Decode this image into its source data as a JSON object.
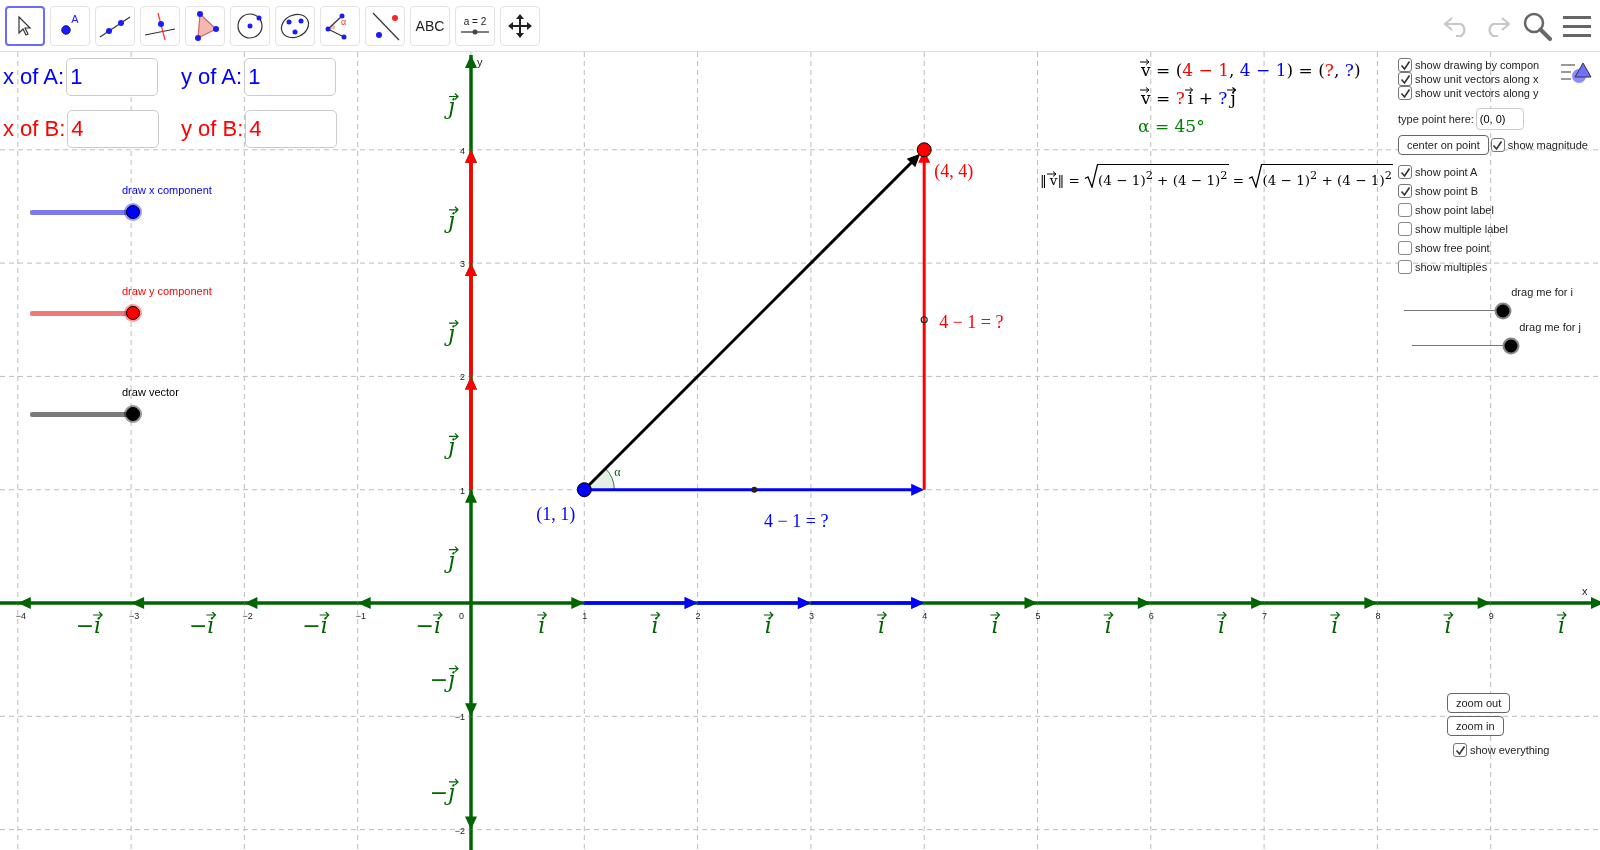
{
  "toolbar": {
    "tools": [
      {
        "kind": "move",
        "selected": true
      },
      {
        "kind": "point",
        "label": "A",
        "selected": false
      },
      {
        "kind": "line",
        "selected": false
      },
      {
        "kind": "perpendicular",
        "selected": false
      },
      {
        "kind": "polygon",
        "selected": false
      },
      {
        "kind": "circle",
        "selected": false
      },
      {
        "kind": "conic",
        "selected": false
      },
      {
        "kind": "angle",
        "label": "α",
        "selected": false
      },
      {
        "kind": "reflect",
        "selected": false
      },
      {
        "kind": "text",
        "label": "ABC",
        "selected": false
      },
      {
        "kind": "slider",
        "label": "a = 2",
        "selected": false
      },
      {
        "kind": "pan",
        "selected": false
      }
    ],
    "undo": {
      "disabled": true
    },
    "redo": {
      "disabled": true
    }
  },
  "inputs": [
    {
      "label": "x of A:",
      "value": "1",
      "color": "#0000ff"
    },
    {
      "label": "y of A:",
      "value": "1",
      "color": "#0000ff"
    },
    {
      "label": "x of B:",
      "value": "4",
      "color": "#ff0000"
    },
    {
      "label": "y of B:",
      "value": "4",
      "color": "#ff0000"
    }
  ],
  "sliders": [
    {
      "label": "draw x component",
      "level": 1,
      "color": "#0000ff"
    },
    {
      "label": "draw y component",
      "level": 1,
      "color": "#ff0000"
    },
    {
      "label": "draw vector",
      "level": 1,
      "color": "#000000"
    }
  ],
  "formulas": [
    [
      {
        "kind": "vector",
        "text": "v"
      },
      {
        "kind": "text",
        "text": " = ("
      },
      {
        "kind": "text",
        "text": "4 − 1",
        "color": "#ff0000"
      },
      {
        "kind": "text",
        "text": ", "
      },
      {
        "kind": "text",
        "text": "4 − 1",
        "color": "#0000ff"
      },
      {
        "kind": "text",
        "text": ") = ("
      },
      {
        "kind": "text",
        "text": "?",
        "color": "#ff0000"
      },
      {
        "kind": "text",
        "text": ", "
      },
      {
        "kind": "text",
        "text": "?",
        "color": "#0000ff"
      },
      {
        "kind": "text",
        "text": ")"
      }
    ],
    [
      {
        "kind": "vector",
        "text": "v"
      },
      {
        "kind": "text",
        "text": " = "
      },
      {
        "kind": "text",
        "text": "?",
        "color": "#ff0000"
      },
      {
        "kind": "vector",
        "text": "i"
      },
      {
        "kind": "text",
        "text": " + "
      },
      {
        "kind": "text",
        "text": "?",
        "color": "#0000ff"
      },
      {
        "kind": "vector",
        "text": "j"
      }
    ],
    [
      {
        "kind": "text",
        "text": "α = 45°",
        "color": "#008000"
      }
    ]
  ],
  "magnitude": [
    {
      "kind": "text",
      "text": "‖"
    },
    {
      "kind": "vector",
      "text": "v"
    },
    {
      "kind": "text",
      "text": "‖ = "
    },
    {
      "kind": "sqrt",
      "text": "(4 − 1)$^{2}$ + (4 − 1)$^{2}$"
    },
    {
      "kind": "text",
      "text": " = "
    },
    {
      "kind": "sqrt",
      "text": "(4 − 1)$^{2}$ + (4 − 1)$^{2}$"
    }
  ],
  "panel": {
    "top_checkboxes": [
      {
        "label": "show drawing by compon",
        "checked": true
      },
      {
        "label": "show unit vectors along x",
        "checked": true
      },
      {
        "label": "show unit vectors along y",
        "checked": true
      }
    ],
    "point_input": {
      "label": "type point here:",
      "value": "(0, 0)"
    },
    "center_button": "center on point",
    "magnitude_checkbox": {
      "label": "show magnitude",
      "checked": true
    },
    "checkboxes": [
      {
        "label": "show point A",
        "checked": true
      },
      {
        "label": "show point B",
        "checked": true
      },
      {
        "label": "show point label",
        "checked": false
      },
      {
        "label": "show multiple label",
        "checked": false
      },
      {
        "label": "show free point",
        "checked": false
      },
      {
        "label": "show multiples",
        "checked": false
      }
    ],
    "drag_sliders": [
      {
        "label": "drag me for i",
        "level": 1
      },
      {
        "label": "drag me for j",
        "level": 1
      }
    ],
    "zoom_buttons": [
      "zoom out",
      "zoom in"
    ],
    "everything_checkbox": {
      "label": "show everything",
      "checked": true
    }
  },
  "graph": {
    "x_axis_label": "x",
    "y_axis_label": "y",
    "x_ticks": [
      "−4",
      "−3",
      "−2",
      "−1",
      "0",
      "1",
      "2",
      "3",
      "4",
      "5",
      "6",
      "7",
      "8",
      "9"
    ],
    "y_ticks": [
      "4",
      "3",
      "2",
      "1",
      "−1",
      "−2"
    ],
    "negative_i_labels": [
      "−i",
      "−i",
      "−i",
      "−i"
    ],
    "i_labels": [
      "i",
      "i",
      "i",
      "i",
      "i",
      "i",
      "i",
      "i",
      "i",
      "i"
    ],
    "j_labels": [
      "j",
      "j",
      "j",
      "j",
      "j"
    ],
    "negative_j_labels": [
      "−j",
      "−j"
    ],
    "point_a_label": "(1, 1)",
    "point_b_label": "(4, 4)",
    "x_component_label": "4 − 1 = ?",
    "y_component_label": "4 − 1 = ?",
    "angle_label": "α"
  }
}
